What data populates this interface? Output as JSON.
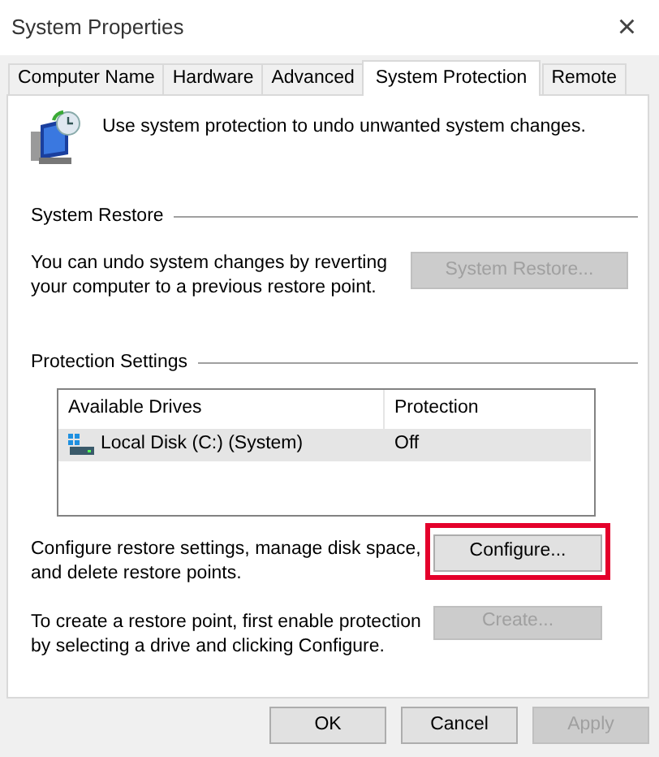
{
  "window": {
    "title": "System Properties",
    "close": "×"
  },
  "tabs": [
    {
      "label": "Computer Name",
      "selected": false
    },
    {
      "label": "Hardware",
      "selected": false
    },
    {
      "label": "Advanced",
      "selected": false
    },
    {
      "label": "System Protection",
      "selected": true
    },
    {
      "label": "Remote",
      "selected": false
    }
  ],
  "intro": "Use system protection to undo unwanted system changes.",
  "system_restore": {
    "heading": "System Restore",
    "text": "You can undo system changes by reverting your computer to a previous restore point.",
    "button": {
      "label": "System Restore...",
      "disabled": true
    }
  },
  "protection_settings": {
    "heading": "Protection Settings",
    "columns": [
      "Available Drives",
      "Protection"
    ],
    "rows": [
      {
        "drive": "Local Disk (C:) (System)",
        "protection": "Off",
        "selected": true
      }
    ],
    "configure": {
      "text": "Configure restore settings, manage disk space, and delete restore points.",
      "button": {
        "label": "Configure...",
        "disabled": false,
        "highlighted": true
      }
    },
    "create": {
      "text": "To create a restore point, first enable protection by selecting a drive and clicking Configure.",
      "button": {
        "label": "Create...",
        "disabled": true
      }
    }
  },
  "buttons": [
    {
      "label": "OK",
      "disabled": false
    },
    {
      "label": "Cancel",
      "disabled": false
    },
    {
      "label": "Apply",
      "disabled": true
    }
  ]
}
